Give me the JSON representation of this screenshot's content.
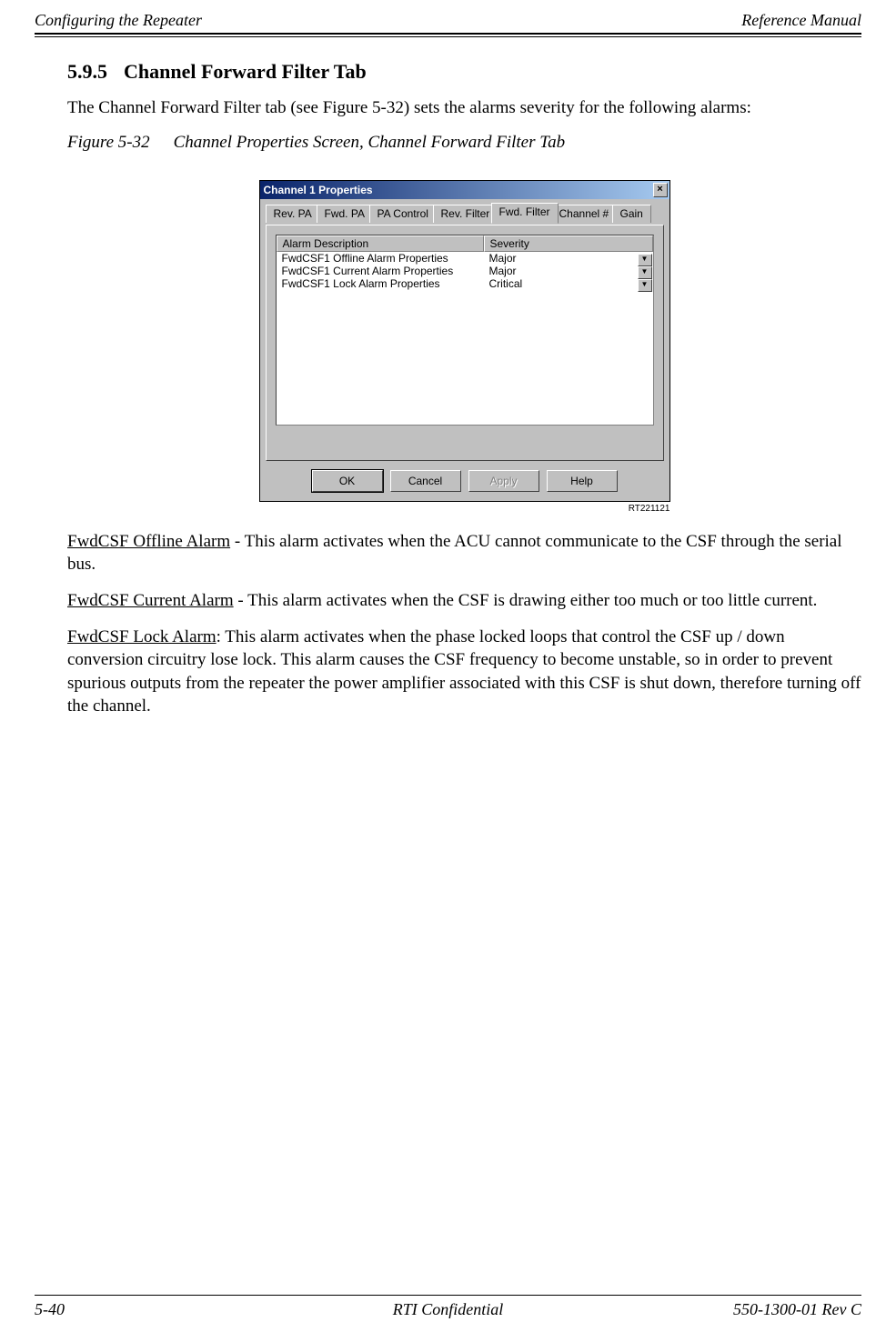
{
  "header": {
    "left": "Configuring the Repeater",
    "right": "Reference Manual"
  },
  "section": {
    "number": "5.9.5",
    "title": "Channel Forward Filter Tab"
  },
  "intro": "The Channel Forward Filter tab (see Figure 5-32) sets the alarms severity for the following alarms:",
  "figure": {
    "num": "Figure 5-32",
    "caption": "Channel Properties Screen, Channel Forward Filter Tab"
  },
  "dialog": {
    "title": "Channel 1 Properties",
    "tabs": [
      "Rev. PA",
      "Fwd. PA",
      "PA Control",
      "Rev. Filter",
      "Fwd. Filter",
      "Channel #",
      "Gain"
    ],
    "active_tab_index": 4,
    "columns": [
      "Alarm Description",
      "Severity"
    ],
    "rows": [
      {
        "desc": "FwdCSF1 Offline Alarm Properties",
        "sev": "Major"
      },
      {
        "desc": "FwdCSF1 Current Alarm Properties",
        "sev": "Major"
      },
      {
        "desc": "FwdCSF1 Lock Alarm Properties",
        "sev": "Critical"
      }
    ],
    "buttons": {
      "ok": "OK",
      "cancel": "Cancel",
      "apply": "Apply",
      "help": "Help"
    },
    "rt_label": "RT221121"
  },
  "paras": {
    "p1_u": "FwdCSF Offline Alarm",
    "p1": " - This alarm activates when the ACU cannot communicate to the CSF through the serial bus.",
    "p2_u": "FwdCSF Current Alarm",
    "p2": " - This alarm activates when the CSF is drawing either too much or too little current.",
    "p3_u": "FwdCSF Lock Alarm",
    "p3": ": This alarm activates when the phase locked loops that control the CSF up / down conversion circuitry lose lock. This alarm causes the CSF frequency to become unstable, so in order to prevent spurious outputs from the repeater the power amplifier associated with this CSF is shut down, therefore turning off the channel."
  },
  "footer": {
    "left": "5-40",
    "center": "RTI Confidential",
    "right": "550-1300-01 Rev C"
  }
}
